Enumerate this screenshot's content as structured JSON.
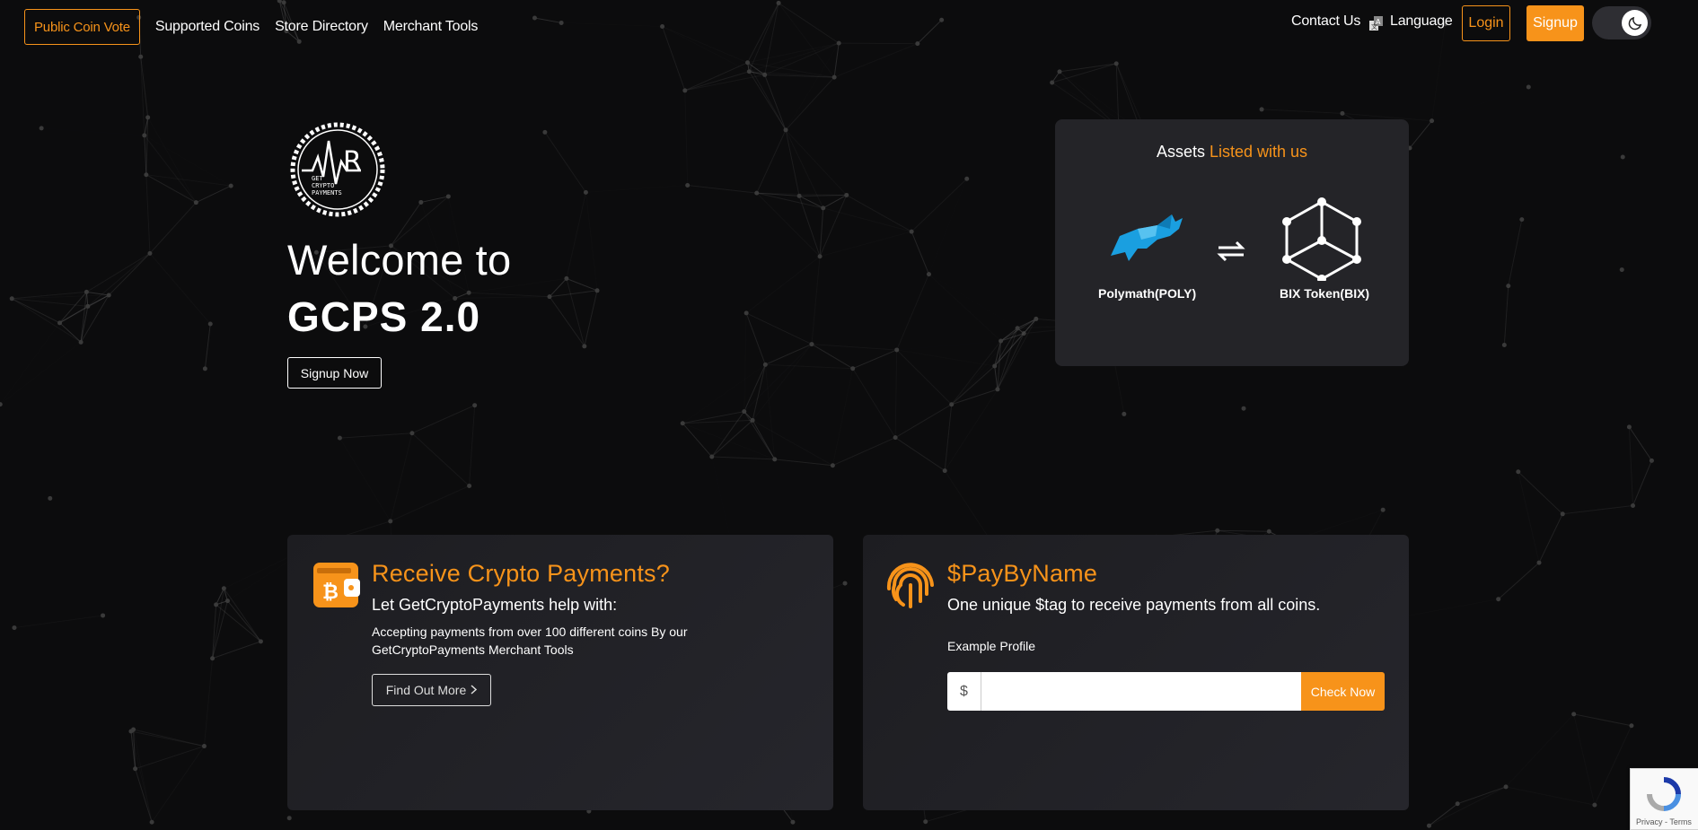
{
  "nav": {
    "public_coin_vote": "Public Coin Vote",
    "links": [
      "Supported Coins",
      "Store Directory",
      "Merchant Tools"
    ],
    "contact": "Contact Us",
    "language": "Language",
    "login": "Login",
    "signup": "Signup",
    "theme_toggle_icon": "moon-icon"
  },
  "hero": {
    "logo_text": [
      "GET",
      "CRYPTO",
      "PAYMENTS"
    ],
    "welcome": "Welcome to",
    "title": "GCPS 2.0",
    "signup_now": "Signup Now"
  },
  "assets": {
    "title_prefix": "Assets",
    "title_highlight": "Listed with us",
    "items": [
      {
        "name": "Polymath(POLY)",
        "icon": "bull-icon"
      },
      {
        "name": "BIX Token(BIX)",
        "icon": "cube-network-icon"
      }
    ],
    "swap_icon": "swap-arrows-icon"
  },
  "cards": {
    "receive": {
      "icon": "wallet-bitcoin-icon",
      "title": "Receive Crypto Payments?",
      "subtitle": "Let GetCryptoPayments help with:",
      "text": "Accepting payments from over 100 different coins By our GetCryptoPayments Merchant Tools",
      "button": "Find Out More"
    },
    "paybyname": {
      "icon": "fingerprint-icon",
      "title": "$PayByName",
      "subtitle": "One unique $tag to receive payments from all coins.",
      "example_label": "Example Profile",
      "prefix": "$",
      "input_value": "",
      "button": "Check Now"
    }
  },
  "recaptcha": {
    "links": "Privacy - Terms"
  },
  "colors": {
    "accent": "#f7931a",
    "background": "#0c0c0d",
    "card": "#222227",
    "poly_blue": "#1a9fe0"
  }
}
